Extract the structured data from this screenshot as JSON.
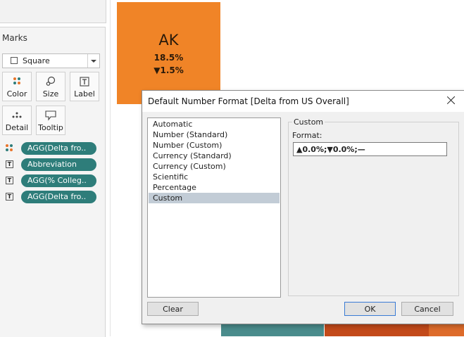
{
  "marks": {
    "title": "Marks",
    "mark_type": "Square",
    "buttons": {
      "color": "Color",
      "size": "Size",
      "label": "Label",
      "detail": "Detail",
      "tooltip": "Tooltip"
    },
    "pills": [
      {
        "icon": "color-dots-icon",
        "label": "AGG(Delta fro.."
      },
      {
        "icon": "text-icon",
        "label": "Abbreviation"
      },
      {
        "icon": "text-icon",
        "label": "AGG(% Colleg.."
      },
      {
        "icon": "text-icon",
        "label": "AGG(Delta fro.."
      }
    ],
    "pill_color": "#2e7d7a"
  },
  "viz": {
    "tile_abbr": "AK",
    "tile_value": "18.5%",
    "tile_delta": "▼1.5%",
    "tile_color": "#f08427"
  },
  "dialog": {
    "title": "Default Number Format [Delta from US Overall]",
    "formats": [
      "Automatic",
      "Number (Standard)",
      "Number (Custom)",
      "Currency (Standard)",
      "Currency (Custom)",
      "Scientific",
      "Percentage",
      "Custom"
    ],
    "selected_format": "Custom",
    "group_title": "Custom",
    "format_label": "Format:",
    "format_value": "▲0.0%;▼0.0%;—",
    "clear_label": "Clear",
    "ok_label": "OK",
    "cancel_label": "Cancel"
  }
}
